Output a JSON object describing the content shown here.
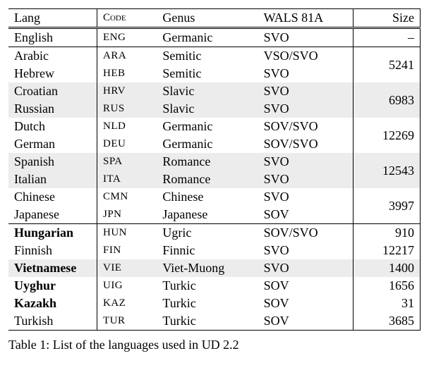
{
  "chart_data": {
    "type": "table",
    "title": "List of the languages used in UD 2.2",
    "columns": [
      "Lang",
      "Code",
      "Genus",
      "WALS 81A",
      "Size"
    ],
    "rows": [
      {
        "lang": "English",
        "code": "ENG",
        "genus": "Germanic",
        "wals": "SVO",
        "size": "–",
        "bold": false,
        "group_sep": true,
        "shade": false
      },
      {
        "lang": "Arabic",
        "code": "ARA",
        "genus": "Semitic",
        "wals": "VSO/SVO",
        "size_span": "5241",
        "bold": false,
        "group_sep": true,
        "shade": false
      },
      {
        "lang": "Hebrew",
        "code": "HEB",
        "genus": "Semitic",
        "wals": "SVO",
        "bold": false,
        "shade": false
      },
      {
        "lang": "Croatian",
        "code": "HRV",
        "genus": "Slavic",
        "wals": "SVO",
        "size_span": "6983",
        "bold": false,
        "shade": true
      },
      {
        "lang": "Russian",
        "code": "RUS",
        "genus": "Slavic",
        "wals": "SVO",
        "bold": false,
        "shade": true
      },
      {
        "lang": "Dutch",
        "code": "NLD",
        "genus": "Germanic",
        "wals": "SOV/SVO",
        "size_span": "12269",
        "bold": false,
        "shade": false
      },
      {
        "lang": "German",
        "code": "DEU",
        "genus": "Germanic",
        "wals": "SOV/SVO",
        "bold": false,
        "shade": false
      },
      {
        "lang": "Spanish",
        "code": "SPA",
        "genus": "Romance",
        "wals": "SVO",
        "size_span": "12543",
        "bold": false,
        "shade": true
      },
      {
        "lang": "Italian",
        "code": "ITA",
        "genus": "Romance",
        "wals": "SVO",
        "bold": false,
        "shade": true
      },
      {
        "lang": "Chinese",
        "code": "CMN",
        "genus": "Chinese",
        "wals": "SVO",
        "size_span": "3997",
        "bold": false,
        "shade": false
      },
      {
        "lang": "Japanese",
        "code": "JPN",
        "genus": "Japanese",
        "wals": "SOV",
        "bold": false,
        "shade": false
      },
      {
        "lang": "Hungarian",
        "code": "HUN",
        "genus": "Ugric",
        "wals": "SOV/SVO",
        "size": "910",
        "bold": true,
        "group_sep": true,
        "shade": false
      },
      {
        "lang": "Finnish",
        "code": "FIN",
        "genus": "Finnic",
        "wals": "SVO",
        "size": "12217",
        "bold": false,
        "shade": false
      },
      {
        "lang": "Vietnamese",
        "code": "VIE",
        "genus": "Viet-Muong",
        "wals": "SVO",
        "size": "1400",
        "bold": true,
        "shade": true
      },
      {
        "lang": "Uyghur",
        "code": "UIG",
        "genus": "Turkic",
        "wals": "SOV",
        "size": "1656",
        "bold": true,
        "shade": false
      },
      {
        "lang": "Kazakh",
        "code": "KAZ",
        "genus": "Turkic",
        "wals": "SOV",
        "size": "31",
        "bold": true,
        "shade": false
      },
      {
        "lang": "Turkish",
        "code": "TUR",
        "genus": "Turkic",
        "wals": "SOV",
        "size": "3685",
        "bold": false,
        "shade": false
      }
    ]
  },
  "header": {
    "lang": "Lang",
    "code": "Code",
    "genus": "Genus",
    "wals": "WALS 81A",
    "size": "Size"
  },
  "caption_prefix": "Table 1: List of the languages used in ",
  "caption_suffix": "UD 2.2"
}
